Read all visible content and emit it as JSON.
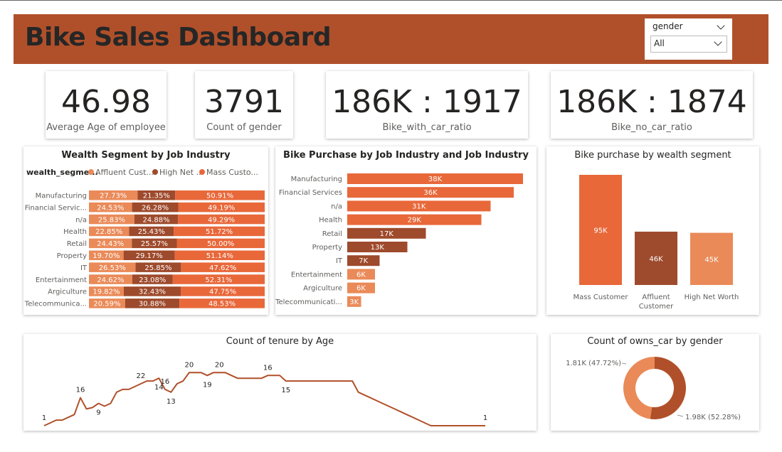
{
  "header": {
    "title": "Bike Sales Dashboard"
  },
  "slicer": {
    "label": "gender",
    "value": "All"
  },
  "kpis": [
    {
      "value": "46.98",
      "label": "Average Age of employee"
    },
    {
      "value": "3791",
      "label": "Count of gender"
    },
    {
      "value": "186K : 1917",
      "label": "Bike_with_car_ratio"
    },
    {
      "value": "186K : 1874",
      "label": "Bike_no_car_ratio"
    }
  ],
  "colors": {
    "affluent": "#ea8a58",
    "high_net": "#9e4a2c",
    "mass": "#e8683a",
    "header": "#b0502a"
  },
  "chart_data": [
    {
      "type": "bar",
      "orientation": "horizontal",
      "stacked": "100%",
      "title": "Wealth Segment by Job Industry",
      "legend_title": "wealth_segme...",
      "categories": [
        "Manufacturing",
        "Financial Servic...",
        "n/a",
        "Health",
        "Retail",
        "Property",
        "IT",
        "Entertainment",
        "Argiculture",
        "Telecommunica..."
      ],
      "series": [
        {
          "name": "Affluent Cust...",
          "values": [
            27.73,
            24.53,
            25.83,
            22.85,
            24.43,
            19.7,
            26.53,
            24.62,
            19.82,
            20.59
          ],
          "labels": [
            "27.73%",
            "24.53%",
            "25.83%",
            "22.85%",
            "24.43%",
            "19.70%",
            "26.53%",
            "24.62%",
            "19.82%",
            "20.59%"
          ]
        },
        {
          "name": "High Net ...",
          "values": [
            21.35,
            26.28,
            24.88,
            25.43,
            25.57,
            29.17,
            25.85,
            23.08,
            32.43,
            30.88
          ],
          "labels": [
            "21.35%",
            "26.28%",
            "24.88%",
            "25.43%",
            "25.57%",
            "29.17%",
            "25.85%",
            "23.08%",
            "32.43%",
            "30.88%"
          ]
        },
        {
          "name": "Mass Custo...",
          "values": [
            50.91,
            49.19,
            49.29,
            51.72,
            50.0,
            51.14,
            47.62,
            52.31,
            47.75,
            48.53
          ],
          "labels": [
            "50.91%",
            "49.19%",
            "49.29%",
            "51.72%",
            "50.00%",
            "51.14%",
            "47.62%",
            "52.31%",
            "47.75%",
            "48.53%"
          ]
        }
      ]
    },
    {
      "type": "bar",
      "orientation": "horizontal",
      "title": "Bike Purchase by Job Industry and Job Industry",
      "categories": [
        "Manufacturing",
        "Financial Services",
        "n/a",
        "Health",
        "Retail",
        "Property",
        "IT",
        "Entertainment",
        "Argiculture",
        "Telecommunicati..."
      ],
      "values": [
        38,
        36,
        31,
        29,
        17,
        13,
        7,
        6,
        6,
        3
      ],
      "labels": [
        "38K",
        "36K",
        "31K",
        "29K",
        "17K",
        "13K",
        "7K",
        "6K",
        "6K",
        "3K"
      ],
      "bar_colors": [
        "#e8683a",
        "#e8683a",
        "#e8683a",
        "#e8683a",
        "#9e4a2c",
        "#9e4a2c",
        "#9e4a2c",
        "#ea8a58",
        "#ea8a58",
        "#ea8a58"
      ]
    },
    {
      "type": "bar",
      "title": "Bike purchase by wealth segment",
      "categories": [
        "Mass Customer",
        "Affluent Customer",
        "High Net Worth"
      ],
      "values": [
        95,
        46,
        45
      ],
      "labels": [
        "95K",
        "46K",
        "45K"
      ],
      "bar_colors": [
        "#e8683a",
        "#9e4a2c",
        "#ea8a58"
      ]
    },
    {
      "type": "line",
      "title": "Count of tenure by Age",
      "x": [
        0,
        1,
        2,
        3,
        4,
        5,
        6,
        7,
        8,
        9,
        10,
        11,
        12,
        13,
        14,
        15,
        16,
        17,
        18,
        19,
        20,
        21,
        22,
        23,
        24,
        25,
        26,
        27,
        28,
        29,
        30,
        31,
        32,
        33,
        34,
        35,
        36,
        37,
        38,
        39,
        40,
        41,
        42,
        43,
        44,
        45,
        46,
        47,
        48,
        49,
        50,
        51,
        52,
        53,
        54,
        55,
        56,
        57,
        58,
        59,
        60,
        61,
        62,
        63,
        64,
        65,
        66,
        67,
        68,
        69,
        70,
        71,
        72,
        73
      ],
      "y": [
        1,
        2,
        3,
        3,
        4,
        5,
        11,
        7,
        7.5,
        9,
        8,
        9,
        13,
        14,
        14,
        15,
        16,
        17,
        17,
        18,
        14,
        13,
        16,
        17,
        20,
        20,
        20,
        19,
        20,
        20,
        20,
        19,
        18,
        18,
        18,
        18,
        18,
        19,
        19,
        19,
        17,
        17,
        17,
        17,
        17,
        17,
        17,
        17,
        17,
        17,
        17,
        17,
        13,
        12,
        11,
        10,
        9,
        8,
        7,
        6,
        5,
        4,
        3,
        2,
        1,
        1,
        1,
        1,
        1,
        1,
        1,
        1,
        1,
        1
      ],
      "point_labels": [
        {
          "i": 0,
          "text": "1"
        },
        {
          "i": 6,
          "text": "16"
        },
        {
          "i": 9,
          "text": "9"
        },
        {
          "i": 16,
          "text": "22"
        },
        {
          "i": 19,
          "text": "14"
        },
        {
          "i": 20,
          "text": "16"
        },
        {
          "i": 21,
          "text": "13"
        },
        {
          "i": 24,
          "text": "20"
        },
        {
          "i": 27,
          "text": "19"
        },
        {
          "i": 29,
          "text": "20"
        },
        {
          "i": 37,
          "text": "16"
        },
        {
          "i": 40,
          "text": "15"
        },
        {
          "i": 73,
          "text": "1"
        }
      ]
    },
    {
      "type": "pie",
      "donut": true,
      "title": "Count of owns_car by gender",
      "slices": [
        {
          "label": "1.98K (52.28%)",
          "value": 52.28,
          "color": "#b0502a"
        },
        {
          "label": "1.81K (47.72%)",
          "value": 47.72,
          "color": "#ea8a58"
        }
      ]
    }
  ]
}
